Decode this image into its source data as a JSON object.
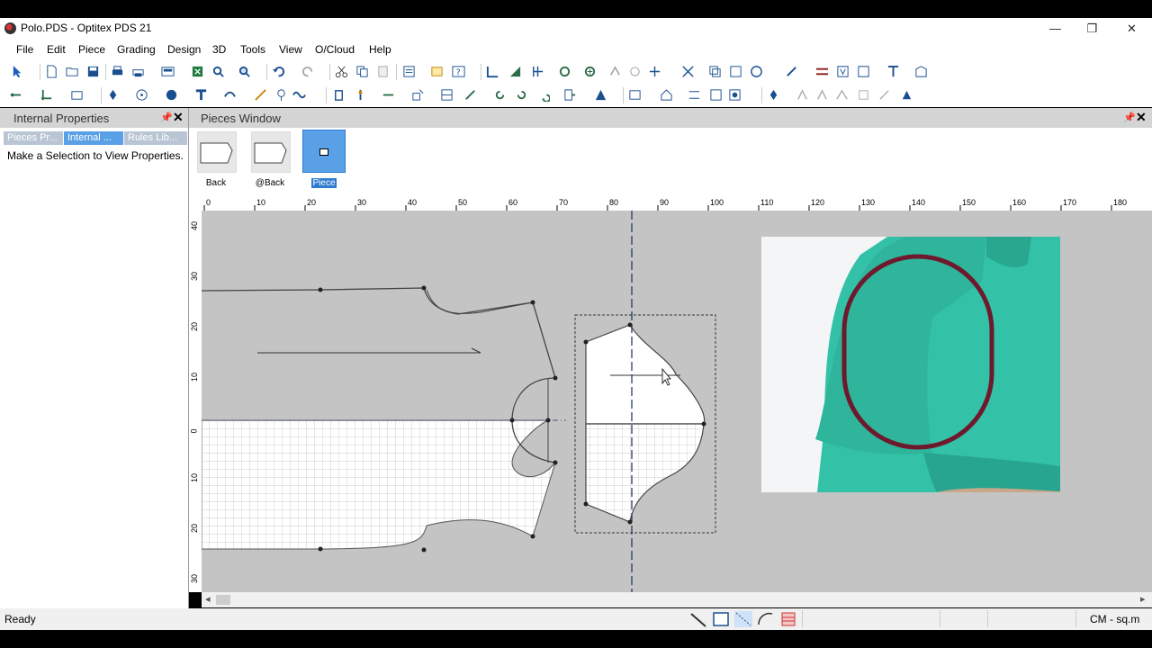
{
  "window": {
    "title": "Polo.PDS - Optitex PDS 21",
    "controls": [
      "—",
      "❐",
      "✕"
    ]
  },
  "menu": [
    "File",
    "Edit",
    "Piece",
    "Grading",
    "Design",
    "3D",
    "Tools",
    "View",
    "O/Cloud",
    "Help"
  ],
  "left_panel": {
    "title": "Internal Properties",
    "tabs": [
      "Pieces Pr...",
      "Internal ...",
      "Rules Lib..."
    ],
    "active_tab": 1,
    "message": "Make a Selection to View Properties."
  },
  "pieces_window": {
    "title": "Pieces Window",
    "pieces": [
      {
        "label": "Back",
        "selected": false
      },
      {
        "label": "@Back",
        "selected": false
      },
      {
        "label": "Piece",
        "selected": true
      }
    ]
  },
  "rulers": {
    "horizontal": [
      "0",
      "10",
      "20",
      "30",
      "40",
      "50",
      "60",
      "70",
      "80",
      "90",
      "100",
      "110",
      "120",
      "130",
      "140",
      "150",
      "160",
      "170",
      "180"
    ],
    "vertical": [
      "40",
      "30",
      "20",
      "10",
      "0",
      "10",
      "20",
      "30"
    ]
  },
  "status": {
    "text": "Ready",
    "units": "CM - sq.m"
  },
  "colors": {
    "selection_blue": "#5aa0e6",
    "canvas_gray": "#c4c4c4",
    "shirt_teal": "#33c2a8",
    "outline_maroon": "#6e1a2c"
  }
}
